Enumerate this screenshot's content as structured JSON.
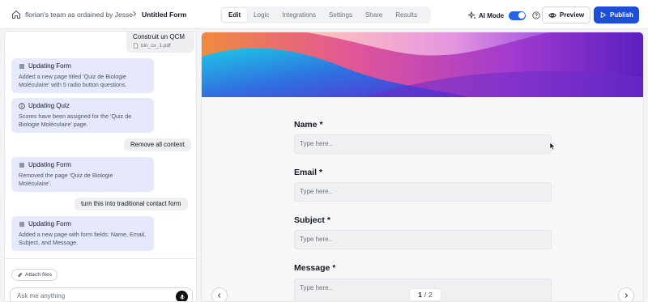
{
  "header": {
    "workspace": "florian's team as ordained by Jesse",
    "form_name": "Untitled Form",
    "tabs": [
      "Edit",
      "Logic",
      "Integrations",
      "Settings",
      "Share",
      "Results"
    ],
    "active_tab": "Edit",
    "ai_mode_label": "AI Mode",
    "ai_mode_on": true,
    "preview_label": "Preview",
    "publish_label": "Publish",
    "accent_color": "#1d4ed8"
  },
  "chat": {
    "user_file": {
      "text": "Construit un QCM",
      "filename": "bin_cv_1.pdf"
    },
    "messages": [
      {
        "kind": "bot",
        "icon": "list-icon",
        "title": "Updating Form",
        "body": "Added a new page titled 'Quiz de Biologie Moléculaire' with 5 radio button questions."
      },
      {
        "kind": "bot",
        "icon": "info-icon",
        "title": "Updating Quiz",
        "body": "Scores have been assigned for the 'Quiz de Biologie Moléculaire' page."
      },
      {
        "kind": "user",
        "text": "Remove all content"
      },
      {
        "kind": "bot",
        "icon": "list-icon",
        "title": "Updating Form",
        "body": "Removed the page 'Quiz de Biologie Moléculaire'."
      },
      {
        "kind": "user",
        "text": "turn this into traditional contact form"
      },
      {
        "kind": "bot",
        "icon": "list-icon",
        "title": "Updating Form",
        "body": "Added a new page with form fields: Name, Email, Subject, and Message."
      }
    ],
    "attach_label": "Attach files",
    "input_placeholder": "Ask me anything"
  },
  "form": {
    "fields": [
      {
        "label": "Name *",
        "placeholder": "Type here.."
      },
      {
        "label": "Email *",
        "placeholder": "Type here.."
      },
      {
        "label": "Subject *",
        "placeholder": "Type here.."
      },
      {
        "label": "Message *",
        "placeholder": "Type here.."
      }
    ],
    "pager": {
      "current": "1",
      "total": "2"
    }
  }
}
